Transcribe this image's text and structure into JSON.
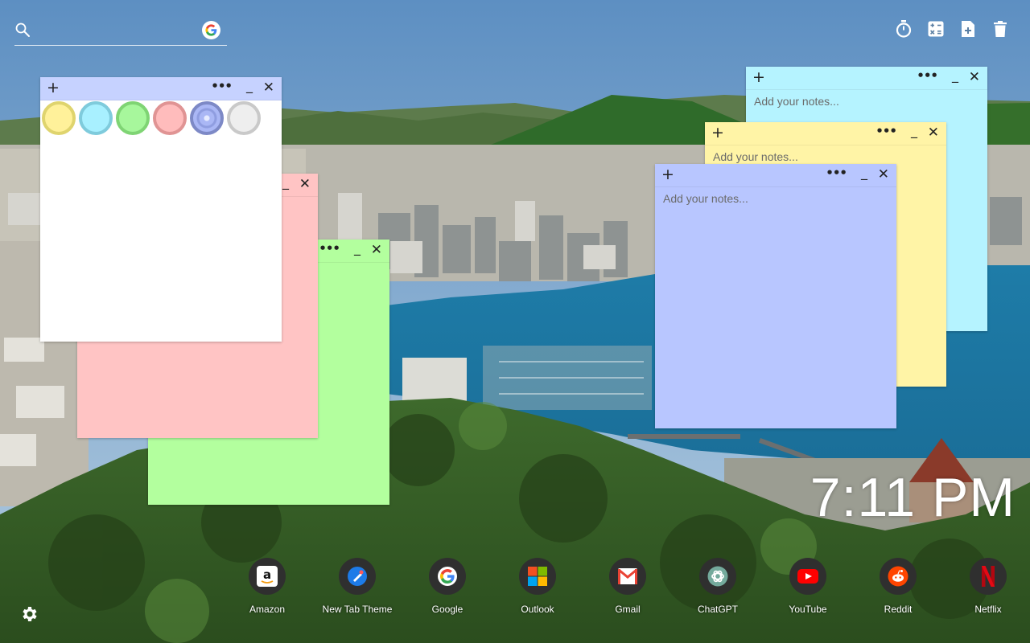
{
  "search": {
    "placeholder": "",
    "icon": "search-icon",
    "engine_icon": "google-icon"
  },
  "tools": [
    {
      "name": "timer-icon"
    },
    {
      "name": "calculator-icon"
    },
    {
      "name": "new-note-icon"
    },
    {
      "name": "trash-icon"
    }
  ],
  "notes": {
    "placeholder": "Add your notes...",
    "add_glyph": "+",
    "more_glyph": "•••",
    "min_glyph": "_",
    "close_glyph": "✕",
    "colors": {
      "white": "#ffffff",
      "pink": "#ffc4c4",
      "green": "#b3ff9e",
      "cyan": "#b5f3ff",
      "yellow": "#fff4a6",
      "blue": "#b8c6ff",
      "blue_bar": "#c6d2ff"
    },
    "swatches": [
      {
        "name": "yellow",
        "fill": "#fff19a",
        "ring": "#dfd46e"
      },
      {
        "name": "cyan",
        "fill": "#a8f0ff",
        "ring": "#7fcbdc"
      },
      {
        "name": "green",
        "fill": "#a7f79c",
        "ring": "#7fd474"
      },
      {
        "name": "pink",
        "fill": "#ffbcbc",
        "ring": "#e09494"
      },
      {
        "name": "blue",
        "fill": "#aab7f5",
        "ring": "#7d89c6"
      },
      {
        "name": "gray",
        "fill": "#eeeeee",
        "ring": "#c9c9c9"
      }
    ]
  },
  "clock": {
    "time": "7:11 PM"
  },
  "shortcuts": [
    {
      "label": "Amazon",
      "icon": "amazon-icon"
    },
    {
      "label": "New Tab Theme",
      "icon": "new-tab-theme-icon"
    },
    {
      "label": "Google",
      "icon": "google-icon"
    },
    {
      "label": "Outlook",
      "icon": "outlook-icon"
    },
    {
      "label": "Gmail",
      "icon": "gmail-icon"
    },
    {
      "label": "ChatGPT",
      "icon": "chatgpt-icon"
    },
    {
      "label": "YouTube",
      "icon": "youtube-icon"
    },
    {
      "label": "Reddit",
      "icon": "reddit-icon"
    },
    {
      "label": "Netflix",
      "icon": "netflix-icon"
    }
  ],
  "settings": {
    "icon": "gear-icon"
  }
}
